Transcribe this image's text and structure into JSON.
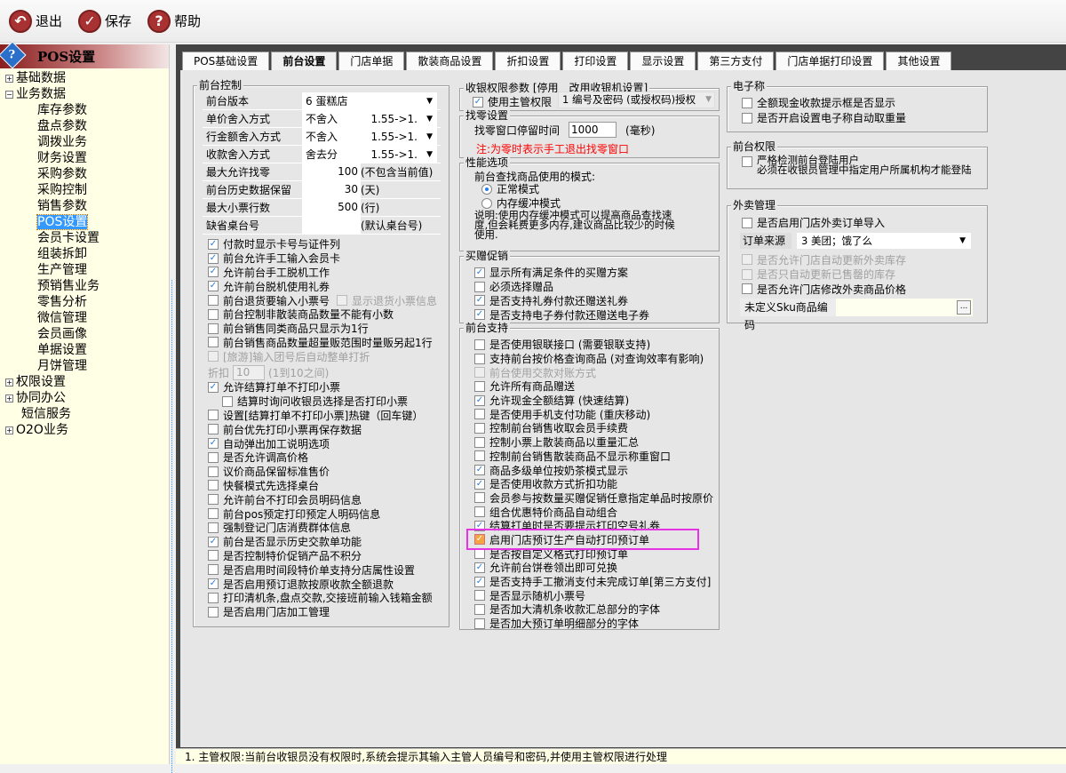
{
  "toolbar": {
    "exit": "退出",
    "save": "保存",
    "help": "帮助"
  },
  "sidebar": {
    "title": "POS设置",
    "items": [
      {
        "label": "基础数据",
        "level": 0,
        "toggle": "+"
      },
      {
        "label": "业务数据",
        "level": 0,
        "toggle": "-"
      },
      {
        "label": "库存参数",
        "level": 1
      },
      {
        "label": "盘点参数",
        "level": 1
      },
      {
        "label": "调拨业务",
        "level": 1
      },
      {
        "label": "财务设置",
        "level": 1
      },
      {
        "label": "采购参数",
        "level": 1
      },
      {
        "label": "采购控制",
        "level": 1
      },
      {
        "label": "销售参数",
        "level": 1
      },
      {
        "label": "POS设置",
        "level": 1,
        "selected": true
      },
      {
        "label": "会员卡设置",
        "level": 1
      },
      {
        "label": "组装拆卸",
        "level": 1
      },
      {
        "label": "生产管理",
        "level": 1
      },
      {
        "label": "预销售业务",
        "level": 1
      },
      {
        "label": "零售分析",
        "level": 1
      },
      {
        "label": "微信管理",
        "level": 1
      },
      {
        "label": "会员画像",
        "level": 1
      },
      {
        "label": "单据设置",
        "level": 1
      },
      {
        "label": "月饼管理",
        "level": 1
      },
      {
        "label": "权限设置",
        "level": 0,
        "toggle": "+"
      },
      {
        "label": "协同办公",
        "level": 0,
        "toggle": "+"
      },
      {
        "label": "短信服务",
        "level": 0
      },
      {
        "label": "O2O业务",
        "level": 0,
        "toggle": "+"
      }
    ]
  },
  "tabs": [
    {
      "label": "POS基础设置"
    },
    {
      "label": "前台设置",
      "active": true
    },
    {
      "label": "门店单据"
    },
    {
      "label": "散装商品设置"
    },
    {
      "label": "折扣设置"
    },
    {
      "label": "打印设置"
    },
    {
      "label": "显示设置"
    },
    {
      "label": "第三方支付"
    },
    {
      "label": "门店单据打印设置"
    },
    {
      "label": "其他设置"
    }
  ],
  "front_control": {
    "title": "前台控制",
    "fields": [
      {
        "label": "前台版本",
        "value": "6 蛋糕店",
        "right": ""
      },
      {
        "label": "单价舍入方式",
        "value": "不舍入",
        "right": "1.55->1."
      },
      {
        "label": "行金额舍入方式",
        "value": "不舍入",
        "right": "1.55->1."
      },
      {
        "label": "收款舍入方式",
        "value": "舍去分",
        "right": "1.55->1."
      }
    ],
    "numbers": [
      {
        "label": "最大允许找零",
        "value": "100",
        "unit": "(不包含当前值)"
      },
      {
        "label": "前台历史数据保留",
        "value": "30",
        "unit": "(天)"
      },
      {
        "label": "最大小票行数",
        "value": "500",
        "unit": "(行)"
      },
      {
        "label": "缺省桌台号",
        "value": "",
        "unit": "(默认桌台号)"
      }
    ],
    "checks_a": [
      {
        "label": "付款时显示卡号与证件列",
        "checked": true
      },
      {
        "label": "前台允许手工输入会员卡",
        "checked": true
      },
      {
        "label": "允许前台手工脱机工作",
        "checked": true
      },
      {
        "label": "允许前台脱机使用礼券",
        "checked": true
      },
      {
        "label": "前台退货要输入小票号",
        "checked": false,
        "extra": "显示退货小票信息"
      },
      {
        "label": "前台控制非散装商品数量不能有小数",
        "checked": false
      },
      {
        "label": "前台销售同类商品只显示为1行",
        "checked": false
      },
      {
        "label": "前台销售商品数量超量贩范围时量贩另起1行",
        "checked": false
      },
      {
        "label": "[旅游]输入团号后自动整单打折",
        "checked": false,
        "disabled": true
      }
    ],
    "discount": {
      "label": "折扣",
      "value": "10",
      "hint": "(1到10之间)"
    },
    "checks_b": [
      {
        "label": "允许结算打单不打印小票",
        "checked": true
      },
      {
        "label": "结算时询问收银员选择是否打印小票",
        "checked": false,
        "indent": true
      },
      {
        "label": "设置[结算打单不打印小票]热键（回车键）",
        "checked": false
      },
      {
        "label": "前台优先打印小票再保存数据",
        "checked": false
      },
      {
        "label": "自动弹出加工说明选项",
        "checked": true
      },
      {
        "label": "是否允许调高价格",
        "checked": false
      },
      {
        "label": "议价商品保留标准售价",
        "checked": false
      },
      {
        "label": "快餐模式先选择桌台",
        "checked": false
      },
      {
        "label": "允许前台不打印会员明码信息",
        "checked": false
      },
      {
        "label": "前台pos预定打印预定人明码信息",
        "checked": false
      },
      {
        "label": "强制登记门店消费群体信息",
        "checked": false
      },
      {
        "label": "前台是否显示历史交款单功能",
        "checked": true
      },
      {
        "label": "是否控制特价促销产品不积分",
        "checked": false
      },
      {
        "label": "是否启用时间段特价单支持分店属性设置",
        "checked": false
      },
      {
        "label": "是否启用预订退款按原收款全额退款",
        "checked": true
      },
      {
        "label": "打印清机条,盘点交款,交接班前输入钱箱金额",
        "checked": false
      },
      {
        "label": "是否启用门店加工管理",
        "checked": false
      }
    ]
  },
  "cashier_perm": {
    "title": "收银权限参数 [停用　改用收银机设置]",
    "check": "使用主管权限",
    "checked": true,
    "select": "1 编号及密码 (或授权码)授权"
  },
  "change": {
    "title": "找零设置",
    "label": "找零窗口停留时间",
    "value": "1000",
    "unit": "(毫秒)",
    "note": "注:为零时表示手工退出找零窗口",
    "note_color": "#ff0000"
  },
  "perf": {
    "title": "性能选项",
    "prompt": "前台查找商品使用的模式:",
    "options": [
      {
        "label": "正常模式",
        "selected": true
      },
      {
        "label": "内存缓冲模式",
        "selected": false
      }
    ],
    "desc": "说明:使用内存缓冲模式可以提高商品查找速度,但会耗费更多内存,建议商品比较少的时候使用."
  },
  "promo": {
    "title": "买赠促销",
    "items": [
      {
        "label": "显示所有满足条件的买赠方案",
        "checked": true
      },
      {
        "label": "必须选择赠品",
        "checked": false
      },
      {
        "label": "是否支持礼券付款还赠送礼券",
        "checked": true
      },
      {
        "label": "是否支持电子券付款还赠送电子券",
        "checked": true
      }
    ]
  },
  "support": {
    "title": "前台支持",
    "items": [
      {
        "label": "是否使用银联接口 (需要银联支持)",
        "checked": false
      },
      {
        "label": "支持前台按价格查询商品 (对查询效率有影响)",
        "checked": false
      },
      {
        "label": "前台使用交款对账方式",
        "checked": false,
        "disabled": true
      },
      {
        "label": "允许所有商品赠送",
        "checked": false
      },
      {
        "label": "允许现金全额结算 (快速结算)",
        "checked": true
      },
      {
        "label": "是否使用手机支付功能 (重庆移动)",
        "checked": false
      },
      {
        "label": "控制前台销售收取会员手续费",
        "checked": false
      },
      {
        "label": "控制小票上散装商品以重量汇总",
        "checked": false
      },
      {
        "label": "控制前台销售散装商品不显示称重窗口",
        "checked": false
      },
      {
        "label": "商品多级单位按奶茶模式显示",
        "checked": true
      },
      {
        "label": "是否使用收款方式折扣功能",
        "checked": true
      },
      {
        "label": "会员参与按数量买赠促销任意指定单品时按原价",
        "checked": false
      },
      {
        "label": "组合优惠特价商品自动组合",
        "checked": false
      },
      {
        "label": "结算打单时是否要提示打印空号礼券",
        "checked": true
      },
      {
        "label": "启用门店预订生产自动打印预订单",
        "checked": true,
        "highlight": true
      },
      {
        "label": "是否按自定义格式打印预订单",
        "checked": false
      },
      {
        "label": "允许前台饼卷领出即可兑换",
        "checked": true
      },
      {
        "label": "是否支持手工撤消支付未完成订单[第三方支付]",
        "checked": true
      },
      {
        "label": "是否显示随机小票号",
        "checked": false
      },
      {
        "label": "是否加大清机条收款汇总部分的字体",
        "checked": false
      },
      {
        "label": "是否加大预订单明细部分的字体",
        "checked": false
      }
    ]
  },
  "scale": {
    "title": "电子称",
    "items": [
      {
        "label": "全额现金收款提示框是否显示",
        "checked": false
      },
      {
        "label": "是否开启设置电子称自动取重量",
        "checked": false
      }
    ]
  },
  "front_perm": {
    "title": "前台权限",
    "check": "严格检测前台登陆用户",
    "line2": "必须在收银员管理中指定用户所属机构才能登陆",
    "checked": false
  },
  "takeout": {
    "title": "外卖管理",
    "import": {
      "label": "是否启用门店外卖订单导入",
      "checked": false
    },
    "source_label": "订单来源",
    "source_value": "3 美团；饿了么",
    "items": [
      {
        "label": "是否允许门店自动更新外卖库存",
        "checked": false,
        "disabled": true
      },
      {
        "label": "是否只自动更新已售罄的库存",
        "checked": false,
        "disabled": true
      },
      {
        "label": "是否允许门店修改外卖商品价格",
        "checked": false
      }
    ],
    "sku_label": "未定义Sku商品编码",
    "sku_value": "",
    "sku_button": "..."
  },
  "footer": "1. 主管权限:当前台收银员没有权限时,系统会提示其输入主管人员编号和密码,并使用主管权限进行处理"
}
